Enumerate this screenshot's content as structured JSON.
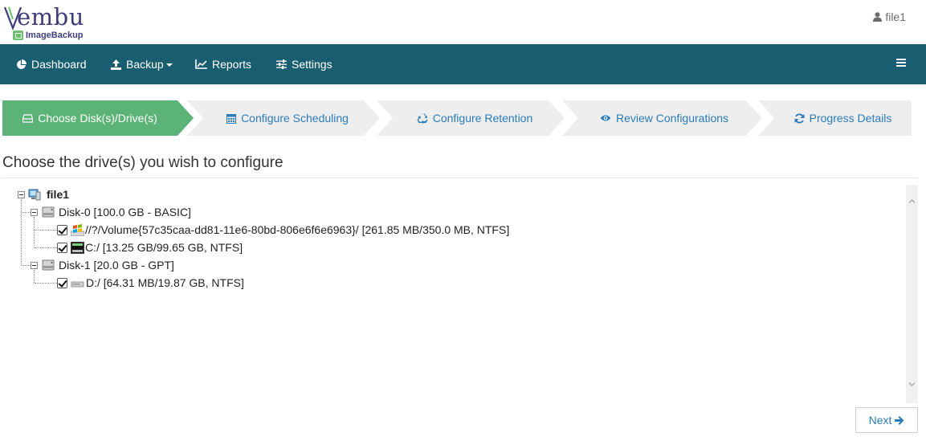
{
  "brand": {
    "name": "embu",
    "product": "ImageBackup"
  },
  "user": {
    "name": "file1"
  },
  "nav": {
    "items": [
      {
        "label": "Dashboard",
        "icon": "pie-chart-icon"
      },
      {
        "label": "Backup",
        "icon": "upload-icon",
        "dropdown": true
      },
      {
        "label": "Reports",
        "icon": "line-chart-icon"
      },
      {
        "label": "Settings",
        "icon": "sliders-icon"
      }
    ]
  },
  "wizard": {
    "steps": [
      {
        "label": "Choose Disk(s)/Drive(s)",
        "icon": "hdd-icon",
        "active": true
      },
      {
        "label": "Configure Scheduling",
        "icon": "calendar-icon",
        "active": false
      },
      {
        "label": "Configure Retention",
        "icon": "recycle-icon",
        "active": false
      },
      {
        "label": "Review Configurations",
        "icon": "eye-icon",
        "active": false
      },
      {
        "label": "Progress Details",
        "icon": "refresh-icon",
        "active": false
      }
    ],
    "active_color": "#5cb377",
    "inactive_color": "#eeeeee"
  },
  "content": {
    "heading": "Choose the drive(s) you wish to configure",
    "tree": {
      "root": "file1",
      "disks": [
        {
          "label": "Disk-0 [100.0 GB - BASIC]",
          "volumes": [
            {
              "label": "//?/Volume{57c35caa-dd81-11e6-80bd-806e6f6e6963}/ [261.85 MB/350.0 MB, NTFS]",
              "checked": true,
              "icon": "windows-icon"
            },
            {
              "label": "C:/ [13.25 GB/99.65 GB, NTFS]",
              "checked": true,
              "icon": "system-drive-icon"
            }
          ]
        },
        {
          "label": "Disk-1 [20.0 GB - GPT]",
          "volumes": [
            {
              "label": "D:/ [64.31 MB/19.87 GB, NTFS]",
              "checked": true,
              "icon": "drive-icon"
            }
          ]
        }
      ]
    }
  },
  "footer": {
    "next_label": "Next"
  },
  "colors": {
    "navbar": "#195e70",
    "link": "#2a7bb8"
  }
}
